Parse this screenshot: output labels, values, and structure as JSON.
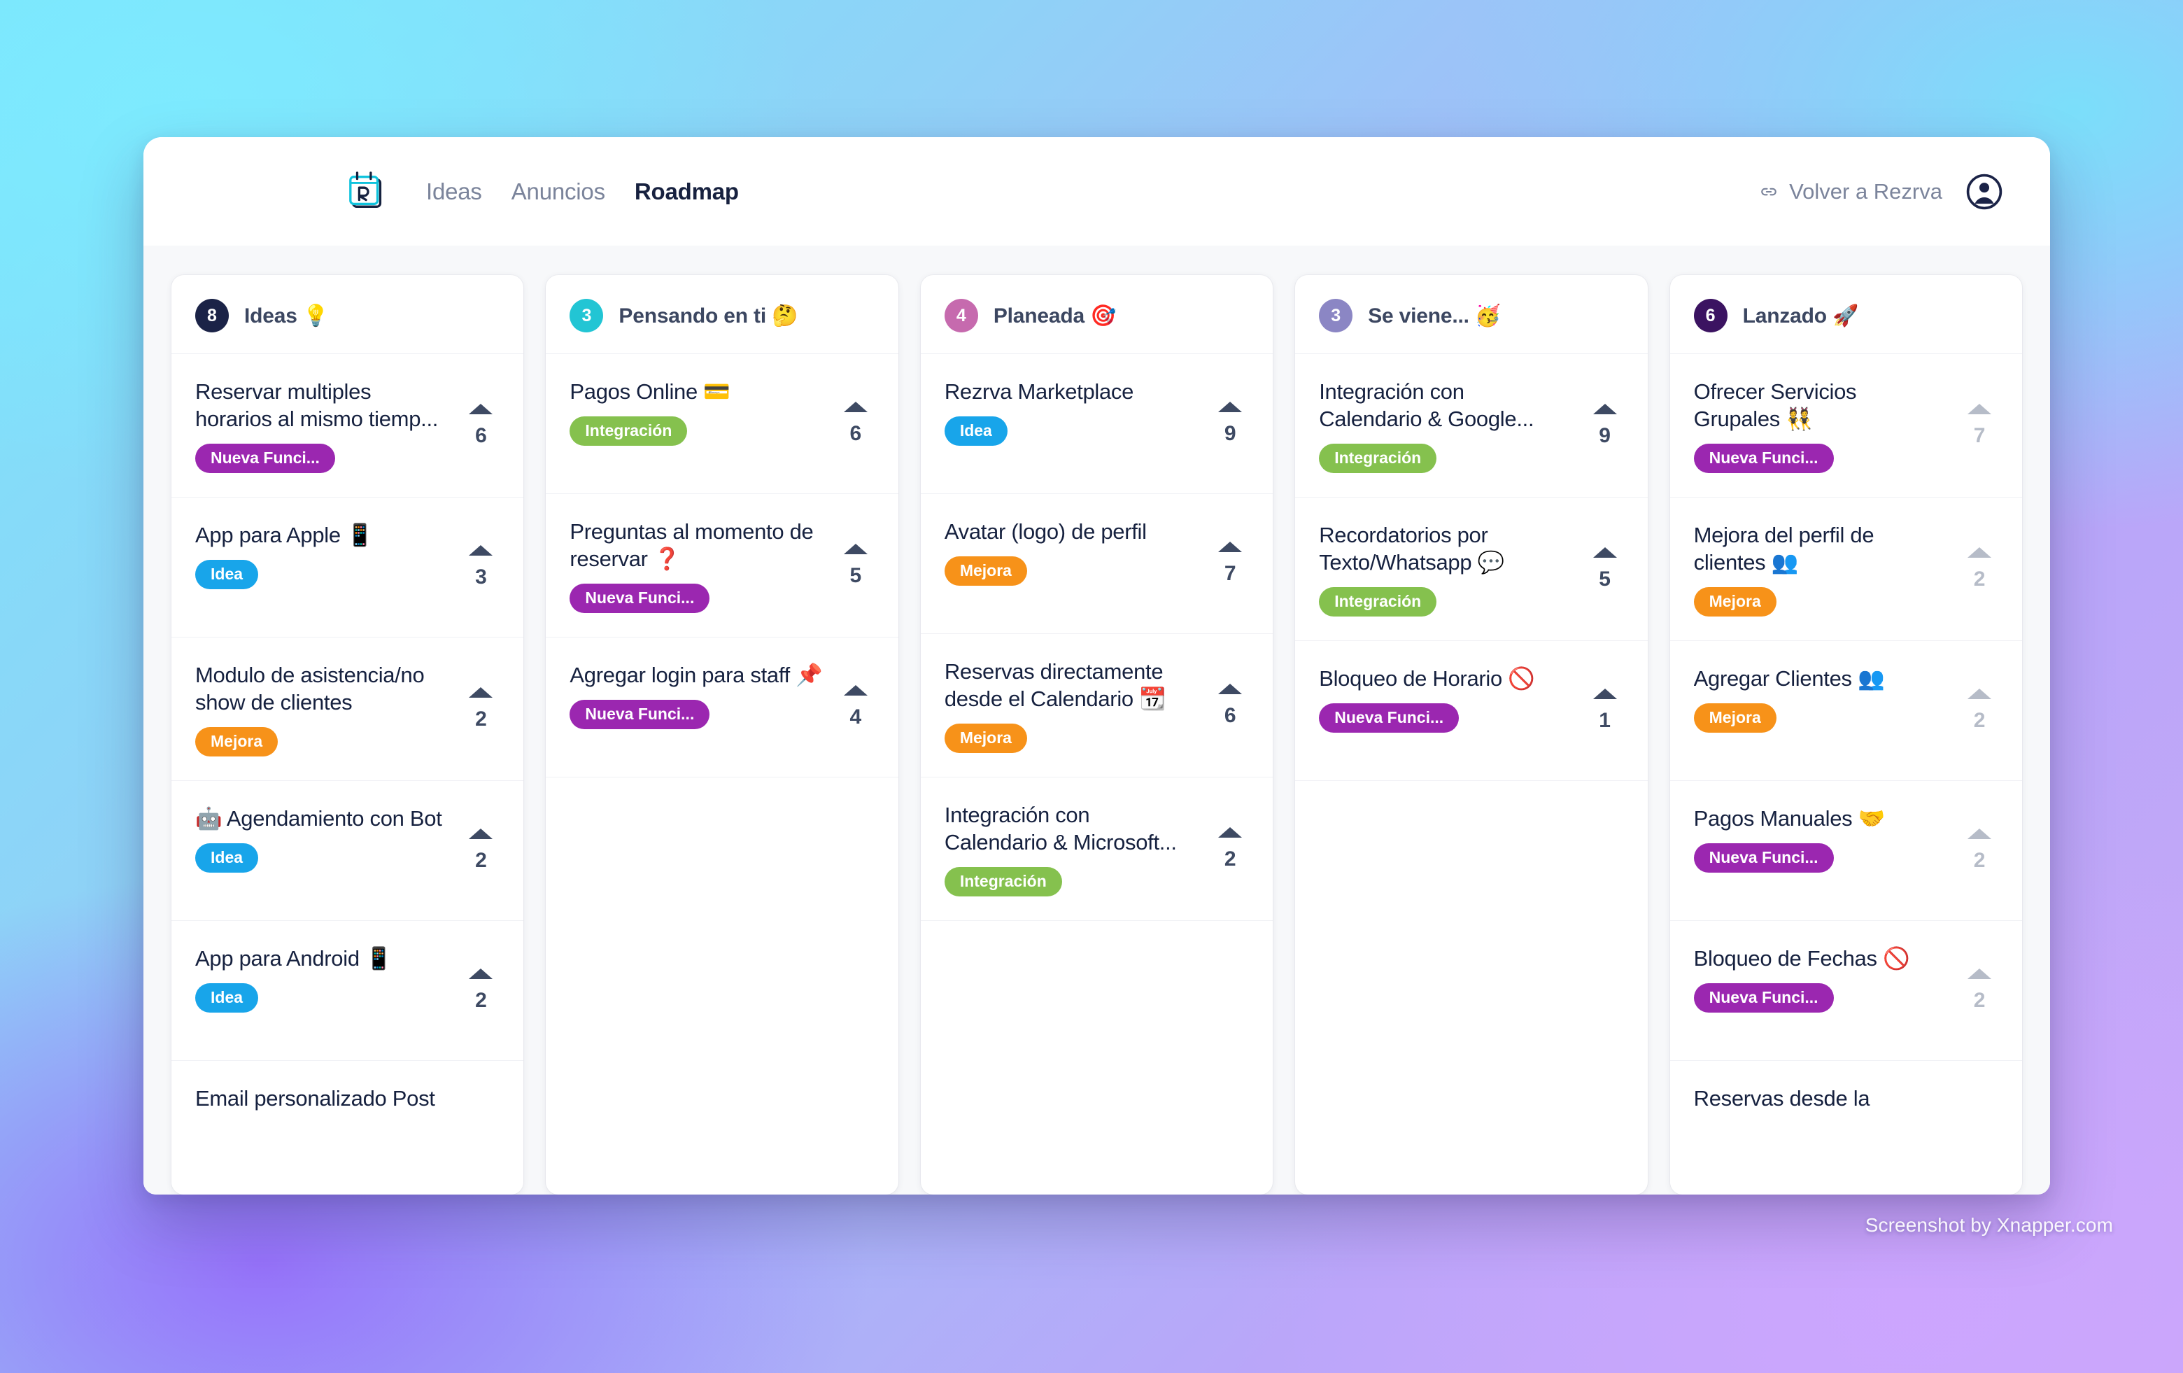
{
  "nav": {
    "logo_icon": "calendar-r-logo-icon",
    "links": [
      {
        "label": "Ideas",
        "active": false
      },
      {
        "label": "Anuncios",
        "active": false
      },
      {
        "label": "Roadmap",
        "active": true
      }
    ],
    "back_link": {
      "label": "Volver a Rezrva",
      "icon": "link-icon"
    },
    "avatar": {
      "icon": "user-avatar-icon"
    }
  },
  "board": {
    "columns": [
      {
        "count": "8",
        "count_color": "#1b2347",
        "title": "Ideas 💡",
        "cards": [
          {
            "title": "Reservar multiples horarios al mismo tiemp...",
            "badge": "Nueva Funci...",
            "badge_color": "#9b27b0",
            "votes": "6",
            "disabled": false
          },
          {
            "title": "App para Apple 📱",
            "badge": "Idea",
            "badge_color": "#18a5ea",
            "votes": "3",
            "disabled": false
          },
          {
            "title": "Modulo de asistencia/no show de clientes",
            "badge": "Mejora",
            "badge_color": "#f79219",
            "votes": "2",
            "disabled": false
          },
          {
            "title": "🤖 Agendamiento con Bot",
            "badge": "Idea",
            "badge_color": "#18a5ea",
            "votes": "2",
            "disabled": false
          },
          {
            "title": "App para Android 📱",
            "badge": "Idea",
            "badge_color": "#18a5ea",
            "votes": "2",
            "disabled": false
          },
          {
            "title": "Email personalizado Post",
            "badge": "",
            "badge_color": "",
            "votes": "",
            "disabled": false
          }
        ]
      },
      {
        "count": "3",
        "count_color": "#22c5d4",
        "title": "Pensando en ti 🤔",
        "cards": [
          {
            "title": "Pagos Online 💳",
            "badge": "Integración",
            "badge_color": "#85c14e",
            "votes": "6",
            "disabled": false
          },
          {
            "title": "Preguntas al momento de reservar ❓",
            "badge": "Nueva Funci...",
            "badge_color": "#9b27b0",
            "votes": "5",
            "disabled": false
          },
          {
            "title": "Agregar login para staff 📌",
            "badge": "Nueva Funci...",
            "badge_color": "#9b27b0",
            "votes": "4",
            "disabled": false
          }
        ]
      },
      {
        "count": "4",
        "count_color": "#c66aae",
        "title": "Planeada 🎯",
        "cards": [
          {
            "title": "Rezrva Marketplace",
            "badge": "Idea",
            "badge_color": "#18a5ea",
            "votes": "9",
            "disabled": false
          },
          {
            "title": "Avatar (logo) de perfil",
            "badge": "Mejora",
            "badge_color": "#f79219",
            "votes": "7",
            "disabled": false
          },
          {
            "title": "Reservas directamente desde el Calendario 📆",
            "badge": "Mejora",
            "badge_color": "#f79219",
            "votes": "6",
            "disabled": false
          },
          {
            "title": "Integración con Calendario & Microsoft...",
            "badge": "Integración",
            "badge_color": "#85c14e",
            "votes": "2",
            "disabled": false
          }
        ]
      },
      {
        "count": "3",
        "count_color": "#8b86c4",
        "title": "Se viene... 🥳",
        "cards": [
          {
            "title": "Integración con Calendario & Google...",
            "badge": "Integración",
            "badge_color": "#85c14e",
            "votes": "9",
            "disabled": false
          },
          {
            "title": "Recordatorios por Texto/Whatsapp 💬",
            "badge": "Integración",
            "badge_color": "#85c14e",
            "votes": "5",
            "disabled": false
          },
          {
            "title": "Bloqueo de Horario 🚫",
            "badge": "Nueva Funci...",
            "badge_color": "#9b27b0",
            "votes": "1",
            "disabled": false
          }
        ]
      },
      {
        "count": "6",
        "count_color": "#3b1361",
        "title": "Lanzado 🚀",
        "cards": [
          {
            "title": "Ofrecer Servicios Grupales 👯",
            "badge": "Nueva Funci...",
            "badge_color": "#9b27b0",
            "votes": "7",
            "disabled": true
          },
          {
            "title": "Mejora del perfil de clientes 👥",
            "badge": "Mejora",
            "badge_color": "#f79219",
            "votes": "2",
            "disabled": true
          },
          {
            "title": "Agregar Clientes 👥",
            "badge": "Mejora",
            "badge_color": "#f79219",
            "votes": "2",
            "disabled": true
          },
          {
            "title": "Pagos Manuales 🤝",
            "badge": "Nueva Funci...",
            "badge_color": "#9b27b0",
            "votes": "2",
            "disabled": true
          },
          {
            "title": "Bloqueo de Fechas 🚫",
            "badge": "Nueva Funci...",
            "badge_color": "#9b27b0",
            "votes": "2",
            "disabled": true
          },
          {
            "title": "Reservas desde la",
            "badge": "",
            "badge_color": "",
            "votes": "",
            "disabled": true
          }
        ]
      }
    ]
  },
  "watermark": {
    "text": "Screenshot by Xnapper.com"
  }
}
